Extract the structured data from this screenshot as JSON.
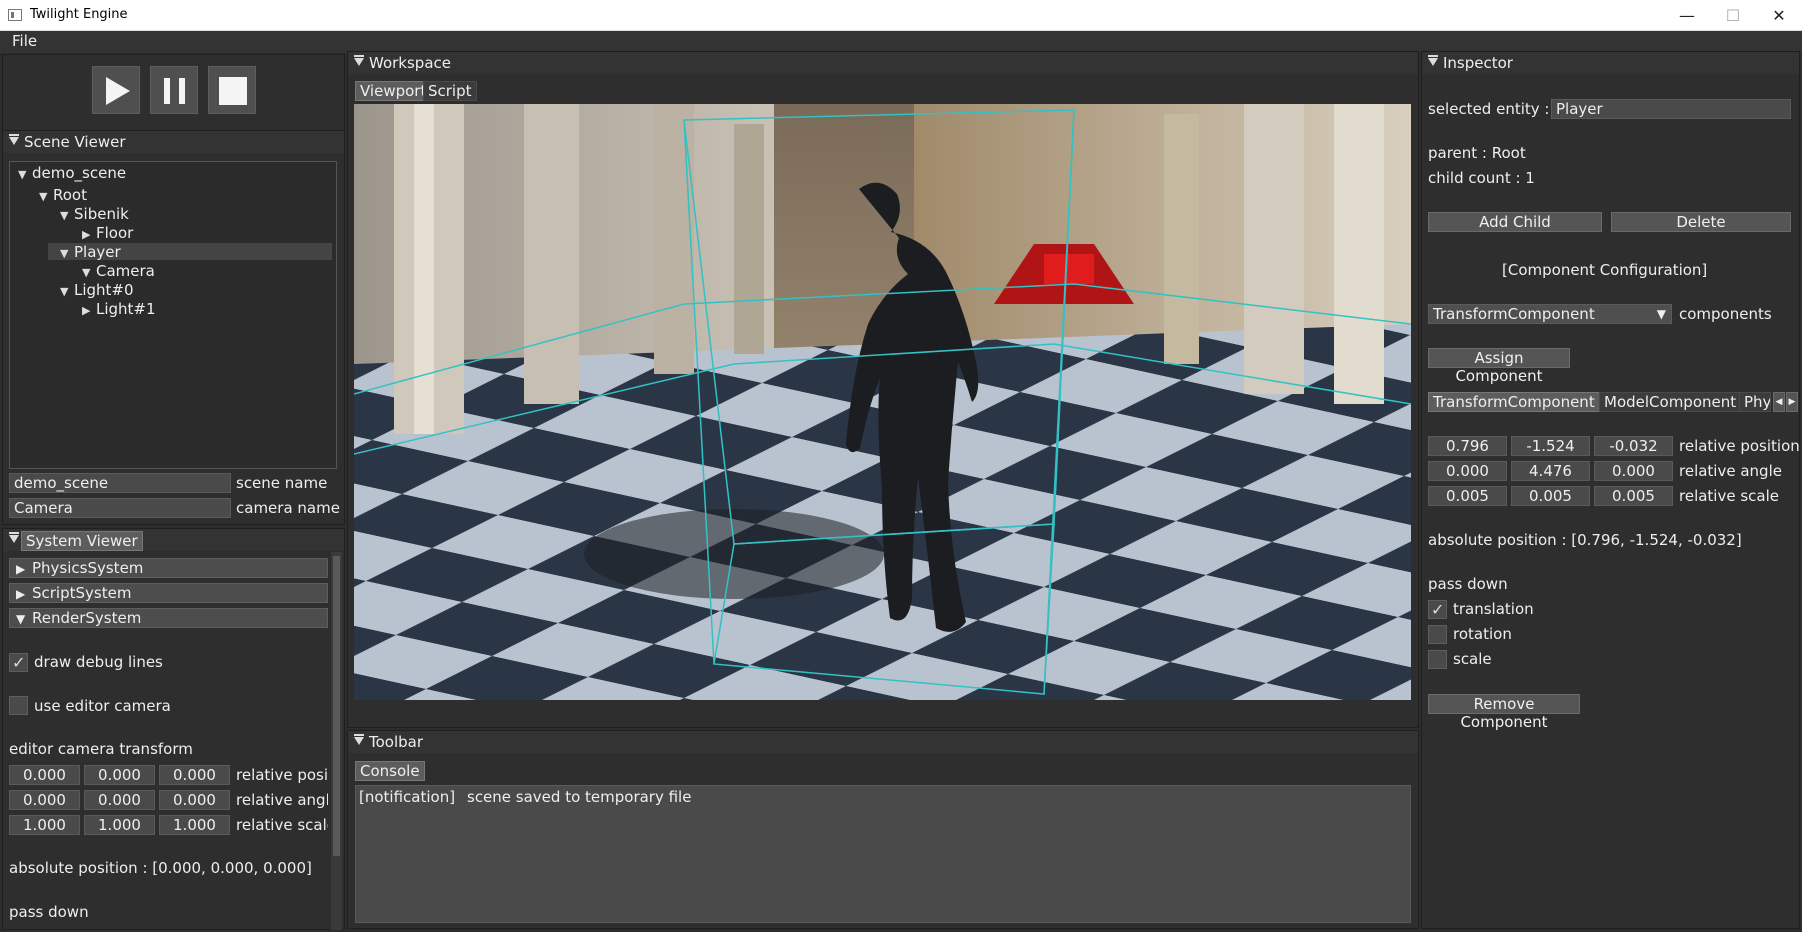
{
  "window": {
    "title": "Twilight Engine",
    "min_glyph": "—",
    "max_glyph": "☐",
    "close_glyph": "✕"
  },
  "menu": {
    "file": "File"
  },
  "scene_viewer": {
    "title": "Scene Viewer",
    "tree": [
      {
        "label": "demo_scene",
        "expanded": true,
        "depth": 0
      },
      {
        "label": "Root",
        "expanded": true,
        "depth": 1
      },
      {
        "label": "Sibenik",
        "expanded": true,
        "depth": 2
      },
      {
        "label": "Floor",
        "expanded": false,
        "depth": 3
      },
      {
        "label": "Player",
        "expanded": true,
        "depth": 2,
        "selected": true
      },
      {
        "label": "Camera",
        "expanded": true,
        "depth": 3
      },
      {
        "label": "Light#0",
        "expanded": true,
        "depth": 2
      },
      {
        "label": "Light#1",
        "expanded": false,
        "depth": 3
      }
    ],
    "scene_name_value": "demo_scene",
    "scene_name_label": "scene name",
    "camera_name_value": "Camera",
    "camera_name_label": "camera name"
  },
  "system_viewer": {
    "title": "System Viewer",
    "systems": [
      "PhysicsSystem",
      "ScriptSystem",
      "RenderSystem"
    ],
    "draw_debug_lines": "draw debug lines",
    "use_editor_camera": "use editor camera",
    "editor_camera_transform": "editor camera transform",
    "rows": [
      {
        "values": [
          "0.000",
          "0.000",
          "0.000"
        ],
        "label": "relative posit"
      },
      {
        "values": [
          "0.000",
          "0.000",
          "0.000"
        ],
        "label": "relative angl"
      },
      {
        "values": [
          "1.000",
          "1.000",
          "1.000"
        ],
        "label": "relative scale"
      }
    ],
    "absolute_position": "absolute position : [0.000, 0.000, 0.000]",
    "pass_down": "pass down"
  },
  "workspace": {
    "title": "Workspace",
    "tabs": [
      "Viewport",
      "Script"
    ]
  },
  "toolbar": {
    "title": "Toolbar",
    "tab": "Console",
    "message_tag": "[notification]",
    "message": "scene saved to temporary file"
  },
  "inspector": {
    "title": "Inspector",
    "selected_entity_label": "selected entity :",
    "selected_entity_value": "Player",
    "parent": "parent : Root",
    "child_count": "child count : 1",
    "add_child": "Add Child",
    "delete": "Delete",
    "component_config": "[Component Configuration]",
    "component_select": "TransformComponent",
    "components_label": "components",
    "assign_component": "Assign Component",
    "component_tabs": [
      "TransformComponent",
      "ModelComponent",
      "Phy"
    ],
    "rows": [
      {
        "values": [
          "0.796",
          "-1.524",
          "-0.032"
        ],
        "label": "relative position"
      },
      {
        "values": [
          "0.000",
          "4.476",
          "0.000"
        ],
        "label": "relative angle"
      },
      {
        "values": [
          "0.005",
          "0.005",
          "0.005"
        ],
        "label": "relative scale"
      }
    ],
    "absolute_position": "absolute position : [0.796, -1.524, -0.032]",
    "pass_down": "pass down",
    "translation": "translation",
    "rotation": "rotation",
    "scale": "scale",
    "remove_component": "Remove Component"
  }
}
